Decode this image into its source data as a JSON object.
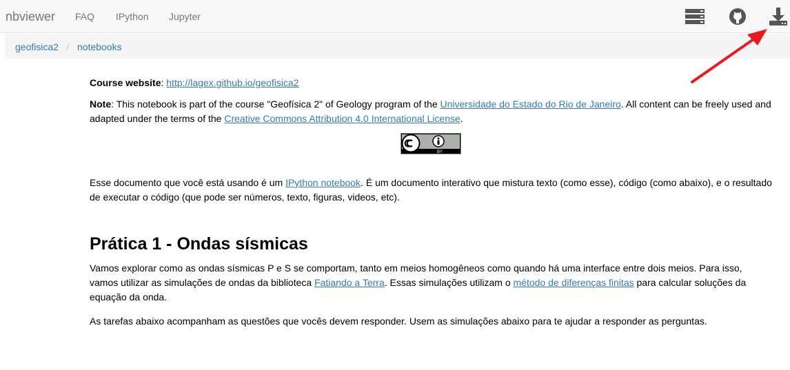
{
  "navbar": {
    "brand": "nbviewer",
    "links": [
      "FAQ",
      "IPython",
      "Jupyter"
    ],
    "icons": [
      "server-icon",
      "github-icon",
      "download-icon"
    ]
  },
  "breadcrumb": {
    "items": [
      "geofisica2",
      "notebooks"
    ],
    "separator": "/"
  },
  "content": {
    "course": {
      "label": "Course website",
      "sep": ": ",
      "link": "http://lagex.github.io/geofisica2"
    },
    "note": {
      "label": "Note",
      "text1": ": This notebook is part of the course \"Geofísica 2\" of Geology program of the ",
      "link1": "Universidade do Estado do Rio de Janeiro",
      "text2": ". All content can be freely used and adapted under the terms of the ",
      "link2": "Creative Commons Attribution 4.0 International License",
      "text3": "."
    },
    "cc_badge": {
      "by": "BY"
    },
    "intro": {
      "text1": "Esse documento que você está usando é um ",
      "link": "IPython notebook",
      "text2": ". É um documento interativo que mistura texto (como esse), código (como abaixo), e o resultado de executar o código (que pode ser números, texto, figuras, videos, etc)."
    },
    "heading": "Prática 1 - Ondas sísmicas",
    "para1": {
      "text1": "Vamos explorar como as ondas sísmicas P e S se comportam, tanto em meios homogêneos como quando há uma interface entre dois meios. Para isso, vamos utilizar as simulações de ondas da biblioteca ",
      "link1": "Fatiando a Terra",
      "text2": ". Essas simulações utilizam o ",
      "link2": "método de diferenças finitas",
      "text3": " para calcular soluções da equação da onda."
    },
    "para2": "As tarefas abaixo acompanham as questões que vocês devem responder. Usem as simulações abaixo para te ajudar a responder as perguntas."
  },
  "colors": {
    "link": "#337ab7",
    "navbar_bg": "#f8f8f8",
    "nav_text": "#777777",
    "annotation_arrow": "#e8191f"
  }
}
